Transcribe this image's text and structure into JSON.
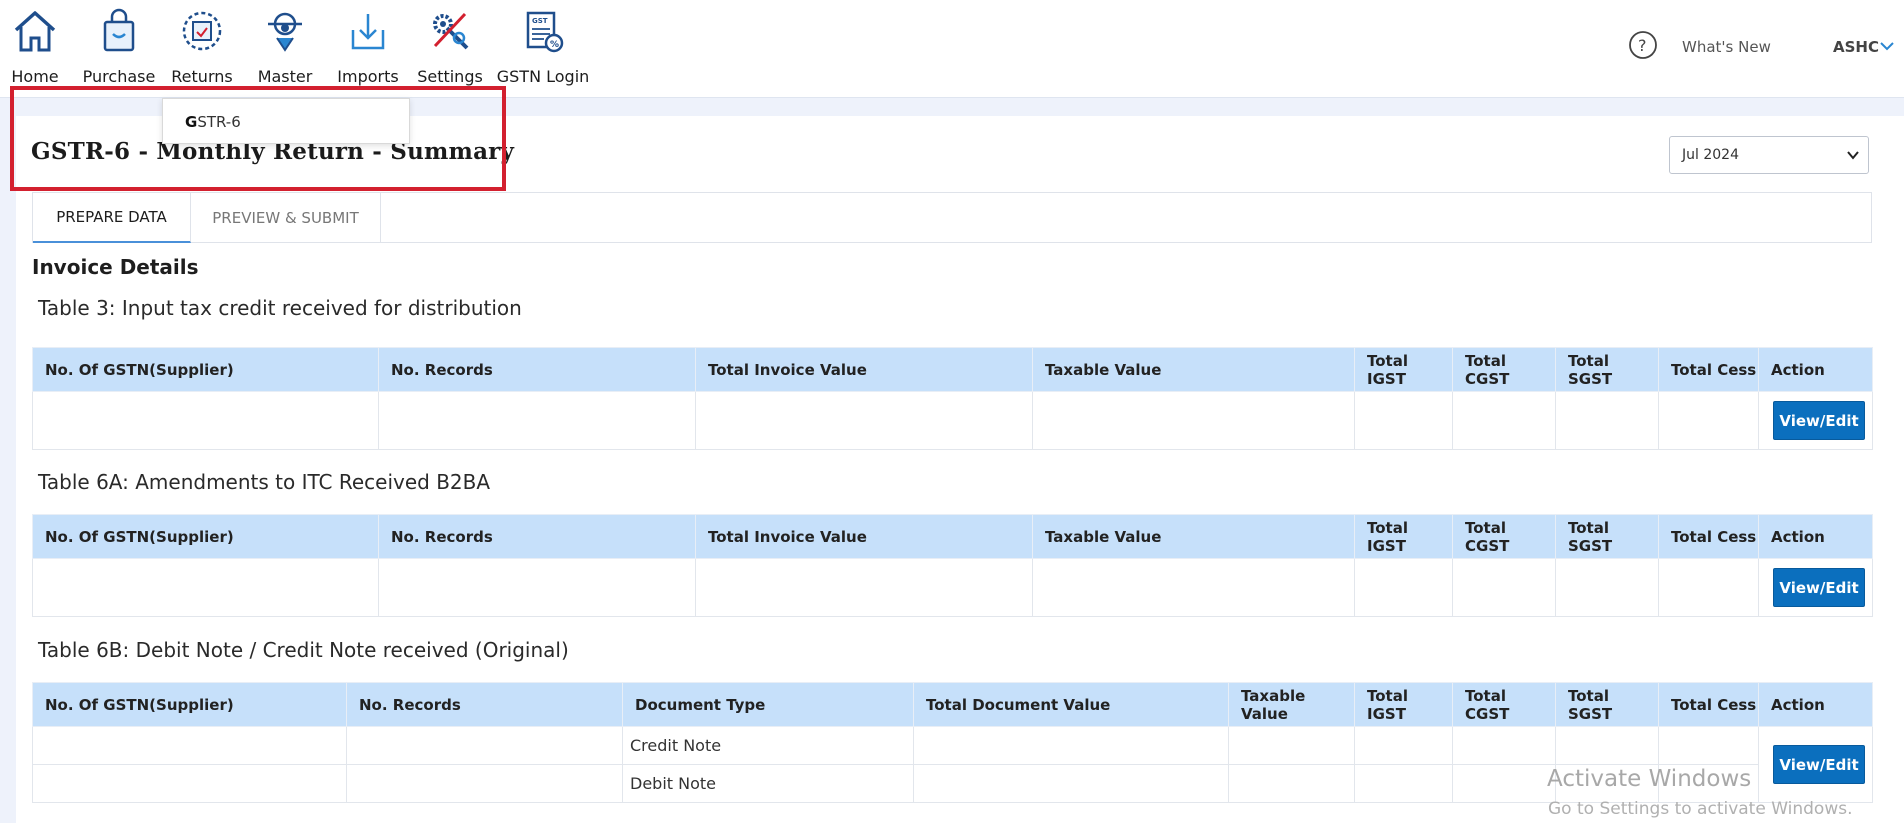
{
  "nav": {
    "items": [
      {
        "label": "Home",
        "icon": "home-icon"
      },
      {
        "label": "Purchase",
        "icon": "shopping-bag-icon"
      },
      {
        "label": "Returns",
        "icon": "returns-icon"
      },
      {
        "label": "Master",
        "icon": "master-icon"
      },
      {
        "label": "Imports",
        "icon": "import-icon"
      },
      {
        "label": "Settings",
        "icon": "tools-icon"
      },
      {
        "label": "GSTN Login",
        "icon": "gst-document-icon"
      }
    ],
    "whats_new": "What's New",
    "user": "ASHC"
  },
  "dropdown": {
    "first_letter": "G",
    "rest": "STR-6"
  },
  "page": {
    "title": "GSTR-6 - Monthly Return - Summary",
    "period": "Jul 2024"
  },
  "tabs": [
    "PREPARE DATA",
    "PREVIEW & SUBMIT"
  ],
  "section_heading": "Invoice Details",
  "table3": {
    "title": "Table 3: Input tax credit received for distribution",
    "headers": [
      "No. Of GSTN(Supplier)",
      "No. Records",
      "Total Invoice Value",
      "Taxable Value",
      "Total IGST",
      "Total CGST",
      "Total SGST",
      "Total Cess",
      "Action"
    ],
    "action_label": "View/Edit"
  },
  "table6a": {
    "title": "Table 6A: Amendments to ITC Received B2BA",
    "headers": [
      "No. Of GSTN(Supplier)",
      "No. Records",
      "Total Invoice Value",
      "Taxable Value",
      "Total IGST",
      "Total CGST",
      "Total SGST",
      "Total Cess",
      "Action"
    ],
    "action_label": "View/Edit"
  },
  "table6b": {
    "title": "Table 6B: Debit Note / Credit Note received (Original)",
    "headers": [
      "No. Of GSTN(Supplier)",
      "No. Records",
      "Document Type",
      "Total Document Value",
      "Taxable Value",
      "Total IGST",
      "Total CGST",
      "Total SGST",
      "Total Cess",
      "Action"
    ],
    "rows": [
      "Credit Note",
      "Debit Note"
    ],
    "action_label": "View/Edit"
  },
  "watermark": {
    "line1": "Activate Windows",
    "line2": "Go to Settings to activate Windows."
  },
  "colors": {
    "header_bg": "#c6e0fa",
    "button": "#0b6fbe",
    "highlight": "#d3202f",
    "nav_icon": "#1f4e8c"
  }
}
